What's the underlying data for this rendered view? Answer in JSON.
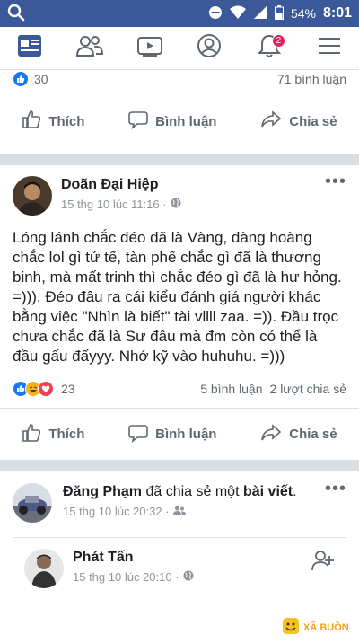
{
  "status": {
    "battery": "54%",
    "time": "8:01"
  },
  "nav": {
    "notification_count": "2"
  },
  "prev_post": {
    "reaction_count": "30",
    "comments": "71 bình luận"
  },
  "actions": {
    "like": "Thích",
    "comment": "Bình luận",
    "share": "Chia sẻ"
  },
  "post1": {
    "author": "Doãn Đại Hiệp",
    "time": "15 thg 10 lúc 11:16 ·",
    "text": "Lóng lánh chắc đéo đã là Vàng, đàng hoàng chắc lol gì tử tế, tàn phế chắc gì đã là thương binh, mà mất trinh thì chắc đéo gì đã là hư hỏng. =))). Đéo đâu ra cái kiểu đánh giá người khác bằng việc \"Nhìn là biết\" tài vllll zaa. =)). Đầu trọc chưa chắc đã là Sư đâu mà đm còn có thể là đầu gấu đấyyy. Nhớ kỹ vào huhuhu. =)))",
    "reaction_count": "23",
    "comments": "5 bình luận",
    "shares": "2 lượt chia sẻ"
  },
  "post2": {
    "author": "Đăng Phạm",
    "shared_text": "đã chia sẻ một",
    "shared_bold": "bài viết",
    "period": ".",
    "time": "15 thg 10 lúc 20:32 ·",
    "inner_author": "Phát Tấn",
    "inner_time": "15 thg 10 lúc 20:10 ·"
  },
  "watermark": {
    "text": "XÃ BUỒN"
  },
  "colors": {
    "brand": "#3b5998",
    "like_blue": "#1877f2",
    "love_red": "#f33e58",
    "haha_yellow": "#f7b125"
  }
}
